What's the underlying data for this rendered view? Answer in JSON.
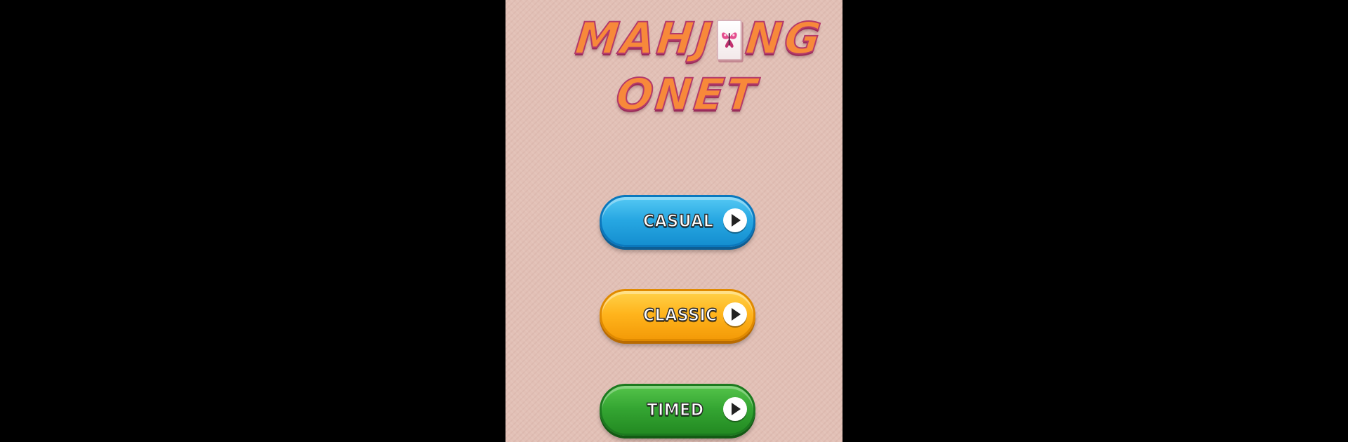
{
  "logo": {
    "line1_part_a": "MAHJ",
    "line1_part_b": "NG",
    "line2": "ONET",
    "tile_icon": "butterfly-tile-icon"
  },
  "menu": {
    "buttons": [
      {
        "label": "CASUAL",
        "icon": "play-icon",
        "color": "#27a7e2"
      },
      {
        "label": "CLASSIC",
        "icon": "play-icon",
        "color": "#ffb41c"
      },
      {
        "label": "TIMED",
        "icon": "play-icon",
        "color": "#34a532"
      }
    ]
  },
  "colors": {
    "background": "#e2c0b6",
    "letterbox": "#000000",
    "logo_fill": "#f7893a",
    "logo_outline": "#b43a6a"
  }
}
